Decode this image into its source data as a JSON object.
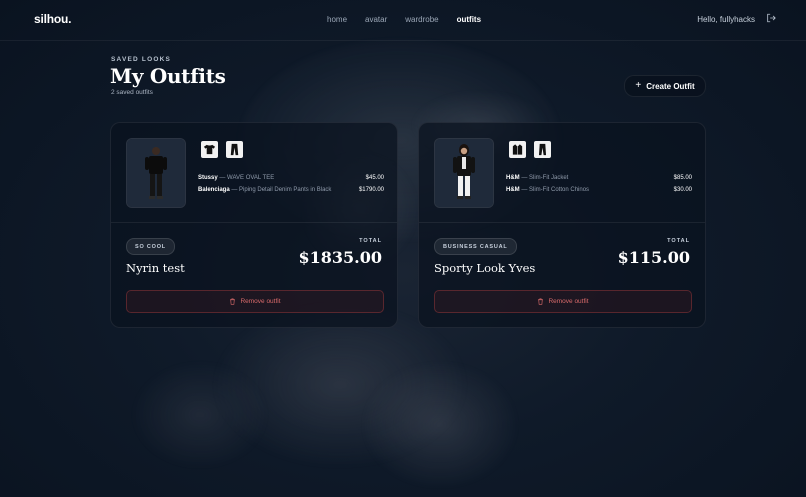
{
  "nav": {
    "logo": "silhou.",
    "links": [
      "home",
      "avatar",
      "wardrobe",
      "outfits"
    ],
    "active": "outfits",
    "greeting": "Hello, fullyhacks",
    "logout_icon": "logout-icon"
  },
  "header": {
    "eyebrow": "SAVED LOOKS",
    "title": "My Outfits",
    "subtitle": "2 saved outfits",
    "create_button": "Create Outfit"
  },
  "outfits": [
    {
      "items": [
        {
          "brand": "Stussy",
          "name": "WAVE OVAL TEE",
          "price": "$45.00",
          "icon": "tshirt-icon"
        },
        {
          "brand": "Balenciaga",
          "name": "Piping Detail Denim Pants in Black",
          "price": "$1790.00",
          "icon": "pants-icon"
        }
      ],
      "tag": "SO COOL",
      "name": "Nyrin test",
      "total_label": "TOTAL",
      "total": "$1835.00",
      "remove_label": "Remove outfit"
    },
    {
      "items": [
        {
          "brand": "H&M",
          "name": "Slim-Fit Jacket",
          "price": "$85.00",
          "icon": "jacket-icon"
        },
        {
          "brand": "H&M",
          "name": "Slim-Fit Cotton Chinos",
          "price": "$30.00",
          "icon": "pants-icon"
        }
      ],
      "tag": "BUSINESS CASUAL",
      "name": "Sporty Look Yves",
      "total_label": "TOTAL",
      "total": "$115.00",
      "remove_label": "Remove outfit"
    }
  ],
  "colors": {
    "background": "#0b1524",
    "danger": "#d86a6a",
    "text": "#ffffff"
  }
}
